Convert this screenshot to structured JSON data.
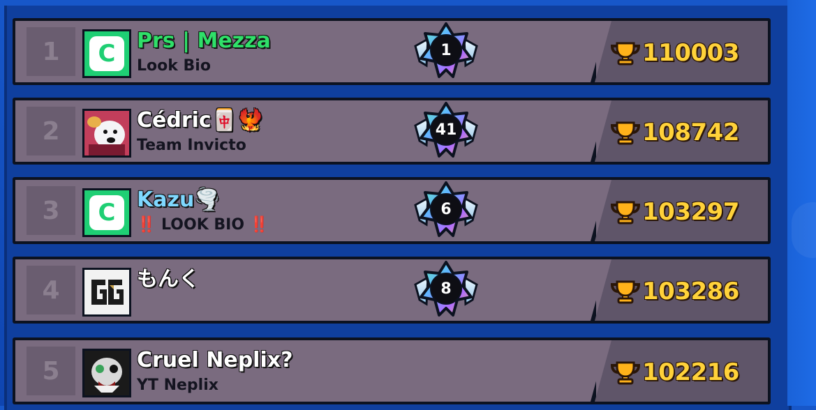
{
  "leaderboard": {
    "rows": [
      {
        "rank": "1",
        "name": "Prs | Mezza",
        "name_color": "#2fe069",
        "subtitle": "Look Bio",
        "subtitle_color": "#141420",
        "avatar_icon": "green-c-avatar-icon",
        "badge_level": "1",
        "trophies": "110003"
      },
      {
        "rank": "2",
        "name": "Cédric🀄🐦‍🔥",
        "name_color": "#ffffff",
        "subtitle": "Team Invicto",
        "subtitle_color": "#141420",
        "avatar_icon": "polar-bear-avatar-icon",
        "badge_level": "41",
        "trophies": "108742"
      },
      {
        "rank": "3",
        "name": "Kazu🌪️",
        "name_color": "#7fd8ff",
        "subtitle": "‼️ LOOK BIO ‼️",
        "subtitle_color": "#141420",
        "avatar_icon": "green-c-avatar-icon",
        "badge_level": "6",
        "trophies": "103297"
      },
      {
        "rank": "4",
        "name": "もんく",
        "name_color": "#ffffff",
        "subtitle": "",
        "subtitle_color": "#141420",
        "avatar_icon": "gg-logo-avatar-icon",
        "badge_level": "8",
        "trophies": "103286"
      },
      {
        "rank": "5",
        "name": "Cruel Neplix?",
        "name_color": "#ffffff",
        "subtitle": "YT Neplix",
        "subtitle_color": "#141420",
        "avatar_icon": "skull-avatar-icon",
        "badge_level": "",
        "trophies": "102216"
      }
    ]
  }
}
